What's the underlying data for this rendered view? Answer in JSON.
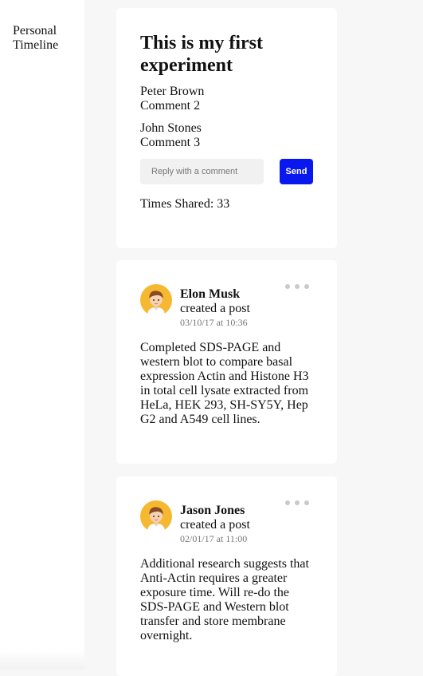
{
  "sidebar": {
    "title": "Personal Timeline"
  },
  "post1": {
    "title": "This is my first experiment",
    "comments": [
      {
        "author": "Peter Brown",
        "text": "Comment 2"
      },
      {
        "author": "John Stones",
        "text": "Comment 3"
      }
    ],
    "reply_placeholder": "Reply with a comment",
    "send_label": "Send",
    "times_shared": "Times Shared: 33"
  },
  "posts": [
    {
      "author": "Elon Musk",
      "action": "created a post",
      "timestamp": "03/10/17 at 10:36",
      "body": "Completed SDS-PAGE and western blot to compare basal expression Actin and Histone H3 in total cell lysate extracted from HeLa, HEK 293, SH-SY5Y, Hep G2 and A549 cell lines."
    },
    {
      "author": "Jason Jones",
      "action": "created a post",
      "timestamp": "02/01/17 at 11:00",
      "body": "Additional research suggests that Anti-Actin requires a greater exposure time. Will re-do the SDS-PAGE and Western blot transfer and store membrane overnight."
    }
  ],
  "icons": {
    "avatar": "user-avatar-icon",
    "more": "more-options-icon"
  },
  "colors": {
    "send_button": "#0a18f0",
    "avatar_bg": "#f6b830",
    "background": "#f7f7f7"
  }
}
